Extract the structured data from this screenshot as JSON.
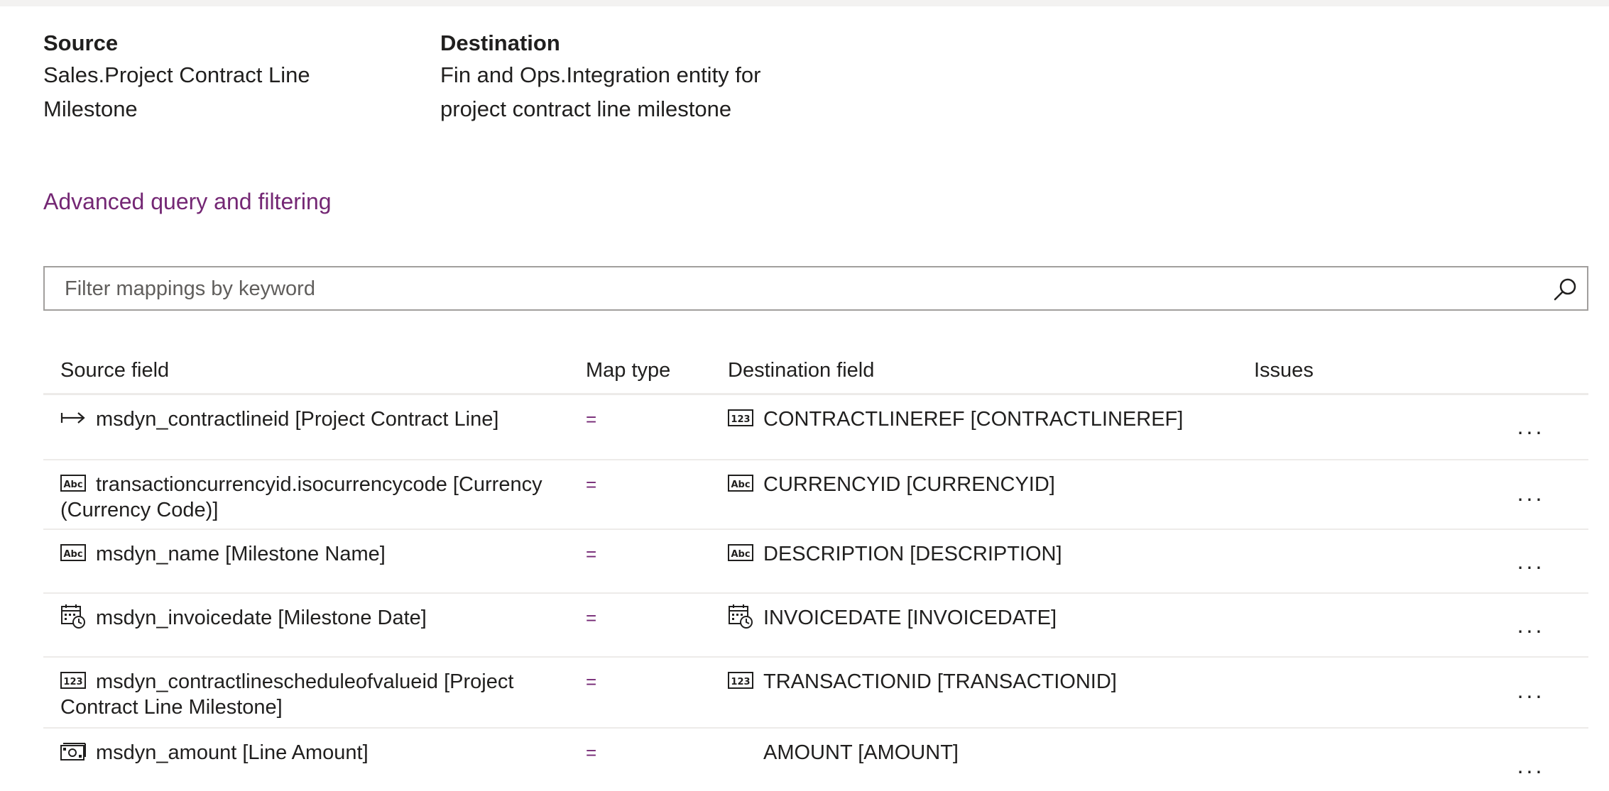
{
  "header": {
    "source_title": "Source",
    "source_line1": "Sales.Project Contract Line",
    "source_line2": "Milestone",
    "destination_title": "Destination",
    "destination_line1": "Fin and Ops.Integration entity for",
    "destination_line2": "project contract line milestone"
  },
  "advanced_link": "Advanced query and filtering",
  "search": {
    "placeholder": "Filter mappings by keyword",
    "icon": "search-icon"
  },
  "table": {
    "columns": {
      "source": "Source field",
      "map_type": "Map type",
      "destination": "Destination field",
      "issues": "Issues"
    },
    "more_label": "...",
    "rows": [
      {
        "source_icon": "key-arrow-icon",
        "source_line1": "msdyn_contractlineid [Project Contract Line]",
        "source_line2": "",
        "map": "=",
        "dest_icon": "number-icon",
        "dest": "CONTRACTLINEREF [CONTRACTLINEREF]"
      },
      {
        "source_icon": "text-icon",
        "source_line1": "transactioncurrencyid.isocurrencycode [Currency",
        "source_line2": "(Currency Code)]",
        "map": "=",
        "dest_icon": "text-icon",
        "dest": "CURRENCYID [CURRENCYID]"
      },
      {
        "source_icon": "text-icon",
        "source_line1": "msdyn_name [Milestone Name]",
        "source_line2": "",
        "map": "=",
        "dest_icon": "text-icon",
        "dest": "DESCRIPTION [DESCRIPTION]"
      },
      {
        "source_icon": "calendar-clock-icon",
        "source_line1": "msdyn_invoicedate [Milestone Date]",
        "source_line2": "",
        "map": "=",
        "dest_icon": "calendar-clock-icon",
        "dest": "INVOICEDATE [INVOICEDATE]"
      },
      {
        "source_icon": "number-icon",
        "source_line1": "msdyn_contractlinescheduleofvalueid [Project",
        "source_line2": "Contract Line Milestone]",
        "map": "=",
        "dest_icon": "number-icon",
        "dest": "TRANSACTIONID [TRANSACTIONID]"
      },
      {
        "source_icon": "money-icon",
        "source_line1": "msdyn_amount [Line Amount]",
        "source_line2": "",
        "map": "=",
        "dest_icon": "",
        "dest": "AMOUNT [AMOUNT]"
      }
    ]
  },
  "colors": {
    "accent": "#742774",
    "border": "#a19f9d",
    "divider": "#edebe9",
    "text": "#201f1e"
  }
}
